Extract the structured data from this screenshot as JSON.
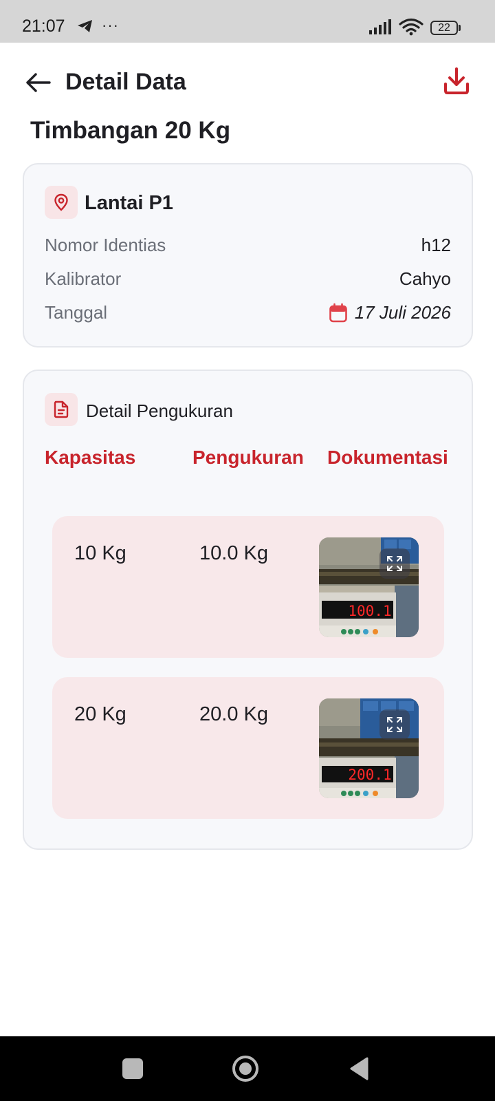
{
  "status_bar": {
    "time": "21:07",
    "more_dots": "···",
    "battery": "22",
    "icons": [
      "telegram-icon",
      "signal-icon",
      "wifi-icon",
      "battery-icon"
    ]
  },
  "app_bar": {
    "title": "Detail Data",
    "back_icon": "arrow-left-icon",
    "download_icon": "download-icon"
  },
  "subject": {
    "title": "Timbangan 20 Kg"
  },
  "info_card": {
    "location_icon": "location-pin-icon",
    "location": "Lantai P1",
    "rows": [
      {
        "label": "Nomor Identias",
        "value": "h12"
      },
      {
        "label": "Kalibrator",
        "value": "Cahyo"
      },
      {
        "label": "Tanggal",
        "value": "17 Juli 2026",
        "icon": "calendar-icon"
      }
    ]
  },
  "measurement_card": {
    "title_icon": "document-icon",
    "title": "Detail Pengukuran",
    "columns": [
      "Kapasitas",
      "Pengukuran",
      "Dokumentasi"
    ],
    "rows": [
      {
        "capacity": "10 Kg",
        "measurement": "10.0 Kg",
        "display_reading": "100.1"
      },
      {
        "capacity": "20 Kg",
        "measurement": "20.0 Kg",
        "display_reading": "200.1"
      }
    ]
  },
  "colors": {
    "accent": "#c8242c",
    "accent_soft": "#f8e5e7",
    "row_bg": "#f8e8ea",
    "card_bg": "#f7f8fb",
    "card_border": "#e5e7ec",
    "muted_text": "#6b6f78",
    "status_bar_bg": "#d6d6d6",
    "nav_bar_bg": "#000000"
  },
  "nav_bar": {
    "icons": [
      "recents-square-icon",
      "home-circle-icon",
      "back-triangle-icon"
    ]
  }
}
